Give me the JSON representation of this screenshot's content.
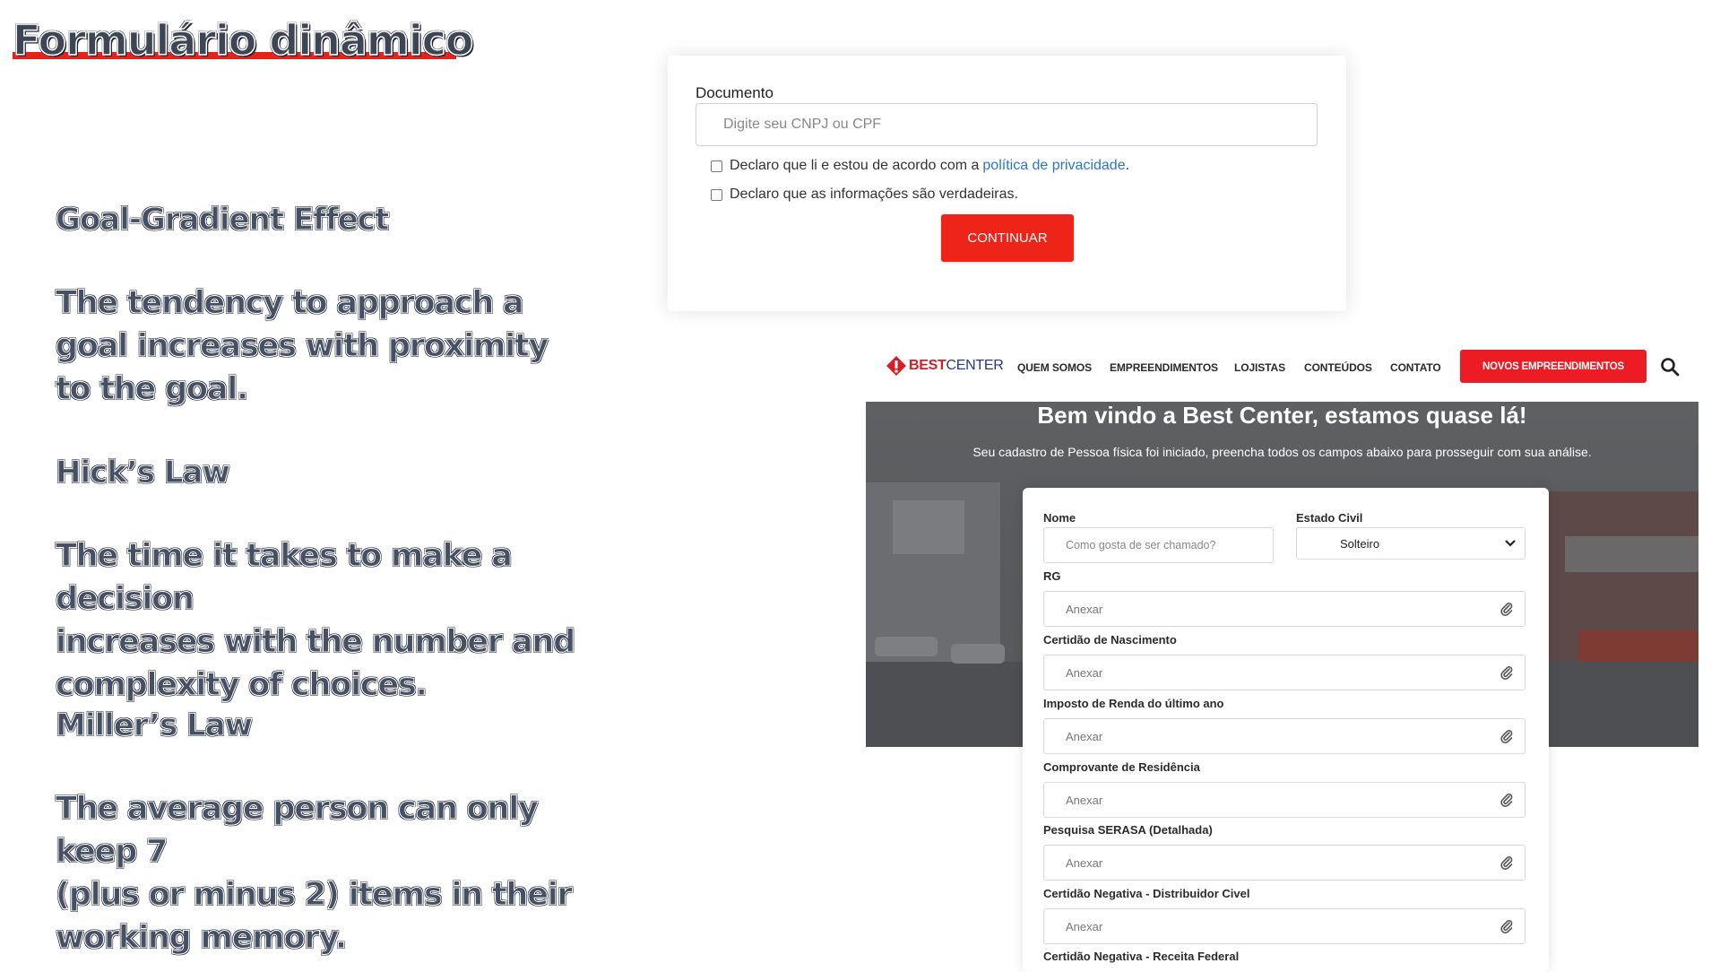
{
  "slide": {
    "title": "Formulário dinâmico",
    "principles": [
      {
        "heading": "Goal-Gradient Effect",
        "lines": [
          "The tendency to approach a",
          "goal increases with proximity",
          "to the goal."
        ]
      },
      {
        "heading": "Hick’s Law",
        "lines": [
          "The time it takes to make a decision",
          "increases with the number and",
          "complexity of choices."
        ]
      },
      {
        "heading": "Miller’s Law",
        "lines": [
          "The average person can only keep 7",
          "(plus or minus 2) items in their",
          "working memory."
        ]
      }
    ]
  },
  "doc_card": {
    "label": "Documento",
    "placeholder": "Digite seu CNPJ ou CPF",
    "checkbox1_text": "Declaro que li e estou de acordo com a ",
    "checkbox1_link": "política de privacidade",
    "checkbox1_end": ".",
    "checkbox2_text": "Declaro que as informações são verdadeiras.",
    "continue_label": "CONTINUAR"
  },
  "site": {
    "logo_best": "BEST",
    "logo_center": "CENTER",
    "nav": [
      "QUEM SOMOS",
      "EMPREENDIMENTOS",
      "LOJISTAS",
      "CONTEÚDOS",
      "CONTATO"
    ],
    "cta": "NOVOS EMPREENDIMENTOS",
    "brand_red": "#ed1c24",
    "brand_blue": "#253a80"
  },
  "hero": {
    "title": "Bem vindo a Best Center, estamos quase lá!",
    "subtitle": "Seu cadastro de Pessoa física foi iniciado, preencha todos os campos abaixo para prosseguir com sua análise."
  },
  "form": {
    "nome_label": "Nome",
    "nome_placeholder": "Como gosta de ser chamado?",
    "estado_label": "Estado Civil",
    "estado_value": "Solteiro",
    "attach_placeholder": "Anexar",
    "fields": [
      "RG",
      "Certidão de Nascimento",
      "Imposto de Renda do último ano",
      "Comprovante de Residência",
      "Pesquisa SERASA (Detalhada)",
      "Certidão Negativa - Distribuidor Civel",
      "Certidão Negativa - Receita Federal"
    ]
  }
}
